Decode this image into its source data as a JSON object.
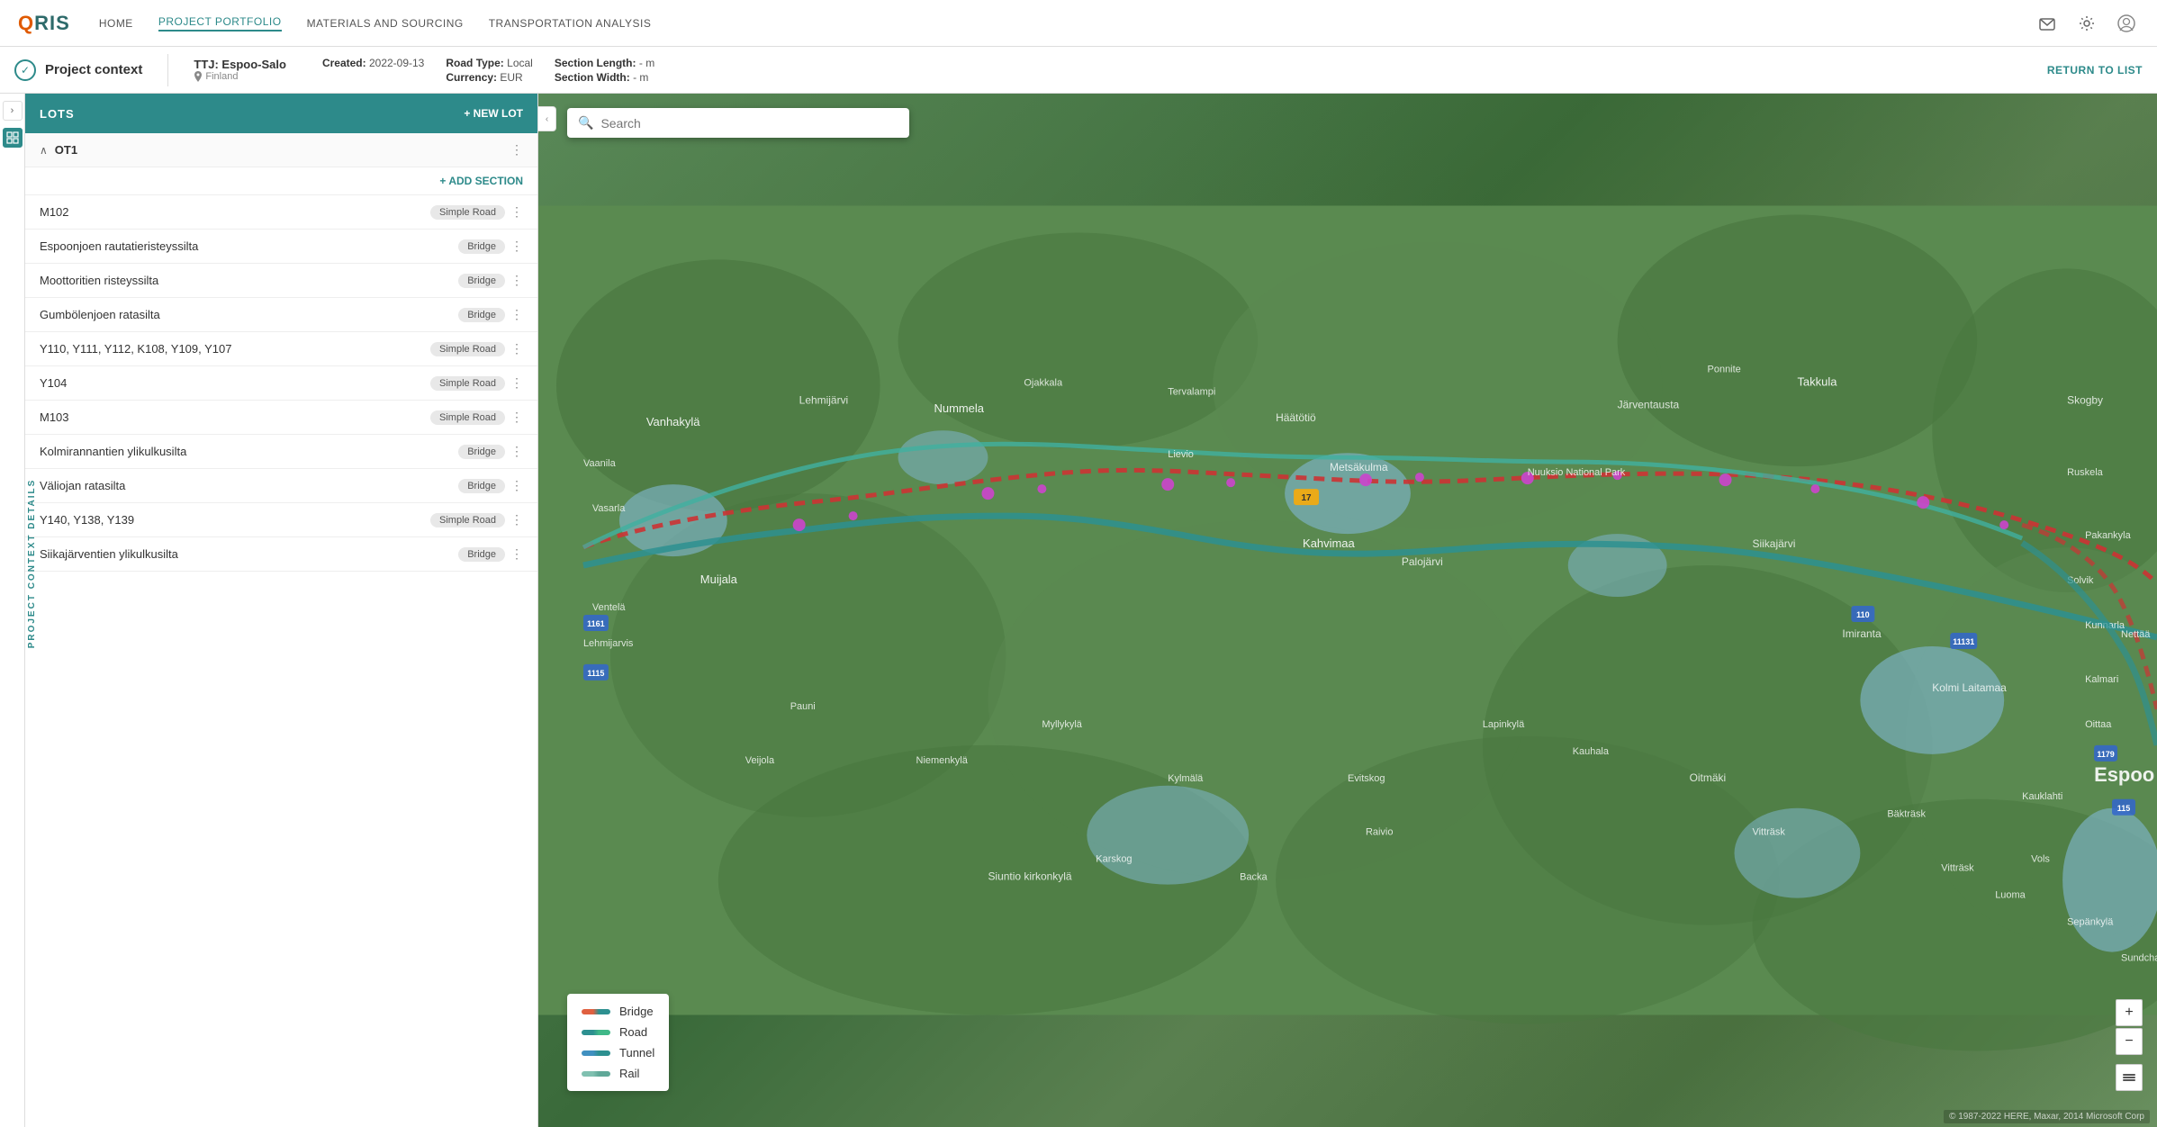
{
  "app": {
    "logo": "QRIS"
  },
  "topnav": {
    "links": [
      {
        "id": "home",
        "label": "HOME",
        "active": false
      },
      {
        "id": "project-portfolio",
        "label": "PROJECT PORTFOLIO",
        "active": true
      },
      {
        "id": "materials-sourcing",
        "label": "MATERIALS AND SOURCING",
        "active": false
      },
      {
        "id": "transportation-analysis",
        "label": "TRANSPORTATION ANALYSIS",
        "active": false
      }
    ]
  },
  "headerbar": {
    "context_label": "Project context",
    "project_name": "TTJ: Espoo-Salo",
    "project_location": "Finland",
    "created_label": "Created:",
    "created_value": "2022-09-13",
    "road_type_label": "Road Type:",
    "road_type_value": "Local",
    "currency_label": "Currency:",
    "currency_value": "EUR",
    "section_length_label": "Section Length:",
    "section_length_value": "- m",
    "section_width_label": "Section Width:",
    "section_width_value": "- m",
    "return_btn": "RETURN TO LIST"
  },
  "lots": {
    "header_label": "LOTS",
    "new_lot_label": "+ NEW LOT",
    "add_section_label": "+ ADD SECTION",
    "group_name": "OT1",
    "sections": [
      {
        "id": "m102",
        "name": "M102",
        "badge": "Simple Road"
      },
      {
        "id": "espoonjoen",
        "name": "Espoonjoen rautatieristeyssilta",
        "badge": "Bridge"
      },
      {
        "id": "moottoritien",
        "name": "Moottoritien risteyssilta",
        "badge": "Bridge"
      },
      {
        "id": "gumbolen",
        "name": "Gumbölenjoen ratasilta",
        "badge": "Bridge"
      },
      {
        "id": "y110",
        "name": "Y110, Y111, Y112, K108, Y109, Y107",
        "badge": "Simple Road"
      },
      {
        "id": "y104",
        "name": "Y104",
        "badge": "Simple Road"
      },
      {
        "id": "m103",
        "name": "M103",
        "badge": "Simple Road"
      },
      {
        "id": "kolmirannan",
        "name": "Kolmirannantien ylikulkusilta",
        "badge": "Bridge"
      },
      {
        "id": "valiojan",
        "name": "Väliojan ratasilta",
        "badge": "Bridge"
      },
      {
        "id": "y140",
        "name": "Y140, Y138, Y139",
        "badge": "Simple Road"
      },
      {
        "id": "siikajarvien",
        "name": "Siikajärventien ylikulkusilta",
        "badge": "Bridge"
      }
    ]
  },
  "sidebar": {
    "vertical_label": "PROJECT CONTEXT DETAILS"
  },
  "map": {
    "search_placeholder": "Search",
    "zoom_in": "+",
    "zoom_out": "−",
    "copyright": "© 1987-2022 HERE, Maxar, 2014 Microsoft Corp"
  },
  "legend": {
    "items": [
      {
        "id": "bridge",
        "label": "Bridge",
        "color": "#e06040"
      },
      {
        "id": "road",
        "label": "Road",
        "color": "#40a840"
      },
      {
        "id": "tunnel",
        "label": "Tunnel",
        "color": "#4090c0"
      },
      {
        "id": "rail",
        "label": "Rail",
        "color": "#80c0b0"
      }
    ]
  }
}
